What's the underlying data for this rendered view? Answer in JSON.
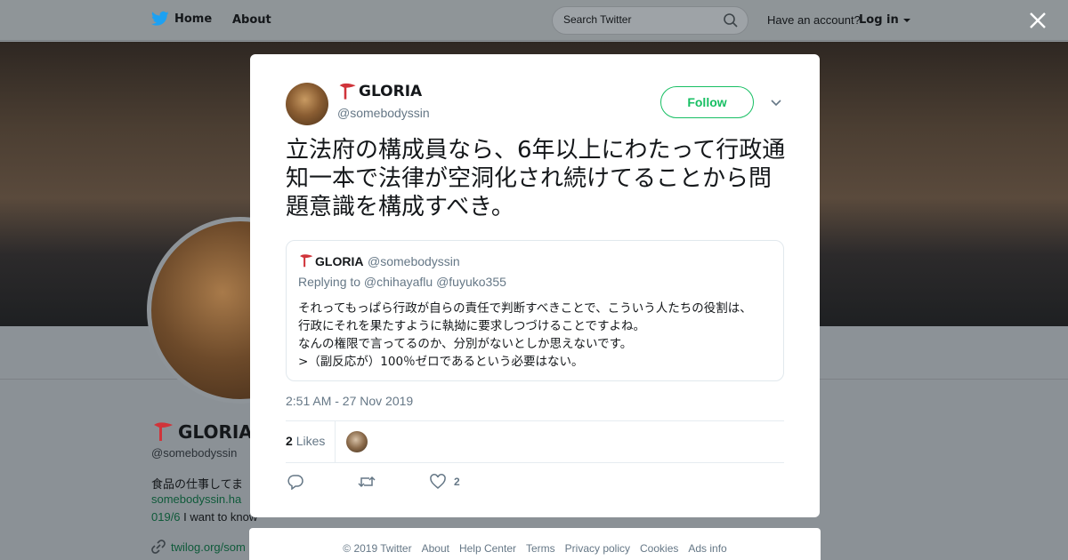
{
  "nav": {
    "home_label": "Home",
    "about_label": "About",
    "search_placeholder": "Search Twitter",
    "have_account": "Have an account?",
    "login_label": "Log in"
  },
  "background_profile": {
    "name": "GLORIA",
    "handle": "@somebodyssin",
    "bio_line1": "食品の仕事してま",
    "link1": "somebodyssin.ha",
    "bio_line2_link": "019/6",
    "bio_line2_text": " I want to know",
    "link2": "twilog.org/som"
  },
  "tweet": {
    "author_name": "GLORIA",
    "author_handle": "@somebodyssin",
    "follow_label": "Follow",
    "text": "立法府の構成員なら、6年以上にわたって行政通知一本で法律が空洞化され続けてることから問題意識を構成すべき。",
    "quoted": {
      "author_name": "GLORIA",
      "author_handle": "@somebodyssin",
      "replying_to": "Replying to @chihayaflu @fuyuko355",
      "lines": [
        "それってもっぱら行政が自らの責任で判断すべきことで、こういう人たちの役割は、",
        "行政にそれを果たすように執拗に要求しつづけることですよね。",
        "なんの権限で言ってるのか、分別がないとしか思えないです。",
        ">（副反応が）100％ゼロであるという必要はない。"
      ]
    },
    "timestamp": "2:51 AM - 27 Nov 2019",
    "likes_count": "2",
    "likes_label": "Likes",
    "like_action_count": "2"
  },
  "footer": {
    "links": [
      "© 2019 Twitter",
      "About",
      "Help Center",
      "Terms",
      "Privacy policy",
      "Cookies",
      "Ads info"
    ]
  },
  "colors": {
    "twitter_blue": "#1da1f2",
    "follow_green": "#17bf63",
    "muted_text": "#657786",
    "flag_red": "#d0343a"
  },
  "icons": [
    "twitter-bird-icon",
    "search-icon",
    "caret-down-icon",
    "close-icon",
    "flag-emoji-icon",
    "chevron-down-icon",
    "reply-icon",
    "retweet-icon",
    "like-heart-icon",
    "link-icon"
  ]
}
